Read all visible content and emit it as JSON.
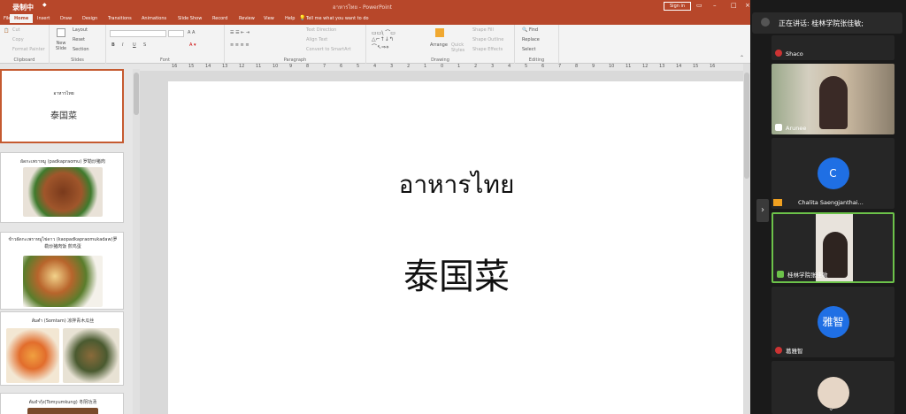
{
  "recording_label": "录制中",
  "titlebar": {
    "document_title": "อาหารไทย - PowerPoint",
    "signin": "Sign in"
  },
  "tabs": [
    "File",
    "Home",
    "Insert",
    "Draw",
    "Design",
    "Transitions",
    "Animations",
    "Slide Show",
    "Record",
    "Review",
    "View",
    "Help"
  ],
  "active_tab": "Home",
  "tell_me": "Tell me what you want to do",
  "ribbon": {
    "clipboard": {
      "label": "Clipboard",
      "paste": "Paste",
      "cut": "Cut",
      "copy": "Copy",
      "format_painter": "Format Painter"
    },
    "slides": {
      "label": "Slides",
      "new_slide": "New Slide",
      "layout": "Layout",
      "reset": "Reset",
      "section": "Section"
    },
    "font": {
      "label": "Font",
      "bold": "B",
      "italic": "I",
      "underline": "U",
      "strike": "S"
    },
    "paragraph": {
      "label": "Paragraph",
      "text_direction": "Text Direction",
      "align_text": "Align Text",
      "smartart": "Convert to SmartArt"
    },
    "drawing": {
      "label": "Drawing",
      "arrange": "Arrange",
      "quick_styles": "Quick Styles",
      "shape_fill": "Shape Fill",
      "shape_outline": "Shape Outline",
      "shape_effects": "Shape Effects"
    },
    "editing": {
      "label": "Editing",
      "find": "Find",
      "replace": "Replace",
      "select": "Select"
    }
  },
  "ruler_marks": [
    "16",
    "15",
    "14",
    "13",
    "12",
    "11",
    "10",
    "9",
    "8",
    "7",
    "6",
    "5",
    "4",
    "3",
    "2",
    "1",
    "0",
    "1",
    "2",
    "3",
    "4",
    "5",
    "6",
    "7",
    "8",
    "9",
    "10",
    "11",
    "12",
    "13",
    "14",
    "15",
    "16"
  ],
  "thumbnails": [
    {
      "line1": "อาหารไทย",
      "line2": "泰国菜",
      "selected": true
    },
    {
      "caption": "ผัดกะเพราหมู (padkapraomu) 罗勒炒猪肉"
    },
    {
      "caption": "ข้าวผัดกะเพราหมูไข่ดาว (kaopadkapraomukadaw)罗勒炒猪肉饭 煎鸡蛋"
    },
    {
      "caption": "ส้มตำ (Somtam) 凉拌青木瓜丝"
    },
    {
      "caption": "ต้มยำกุ้ง(Tomyumkung) 冬阴功汤"
    }
  ],
  "slide": {
    "thai_title": "อาหารไทย",
    "chinese_title": "泰国菜"
  },
  "zoom": {
    "speaking_label": "正在讲话: 桂林学院张佳敏;",
    "participants": [
      {
        "name": "Shaco",
        "type": "video-top"
      },
      {
        "name": "Arunee",
        "type": "video"
      },
      {
        "name": "Chalita Saengjanthai...",
        "type": "avatar",
        "initial": "C"
      },
      {
        "name": "桂林学院张佳敏",
        "type": "video",
        "active": true
      },
      {
        "name": "葛雅智",
        "type": "avatar",
        "initial": "雅智"
      },
      {
        "name": "",
        "type": "video-bottom"
      }
    ]
  },
  "colors": {
    "ppt_accent": "#b7472a",
    "zoom_bg": "#1a1a1a",
    "avatar_blue": "#1f6fe4",
    "active_border": "#6cc24a"
  }
}
